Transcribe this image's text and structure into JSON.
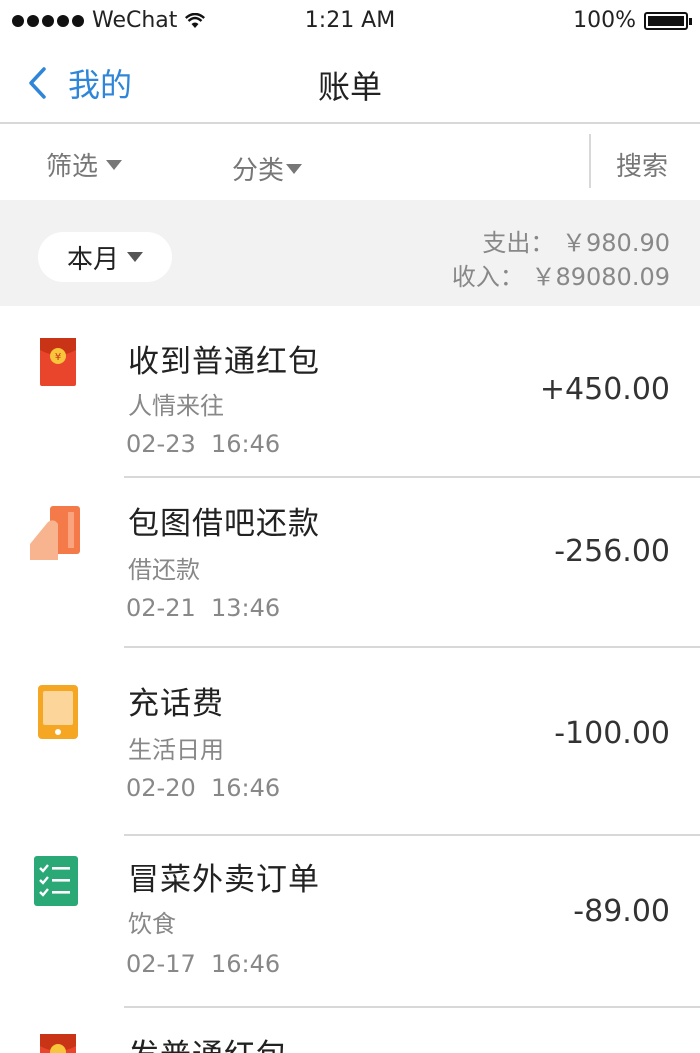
{
  "status_bar": {
    "carrier": "WeChat",
    "time": "1:21 AM",
    "battery_pct": "100%",
    "battery_level": 1.0
  },
  "nav": {
    "back_label": "我的",
    "title": "账单"
  },
  "filters": {
    "filter_label": "筛选",
    "category_label": "分类",
    "search_label": "搜索"
  },
  "summary": {
    "month_label": "本月",
    "expense_label": "支出：",
    "expense_value": "￥980.90",
    "income_label": "收入：",
    "income_value": "￥89080.09"
  },
  "transactions": [
    {
      "title": "收到普通红包",
      "category": "人情来往",
      "date": "02-23",
      "time": "16:46",
      "amount": "+450.00",
      "icon": "red-envelope-icon",
      "color": "#e8452c"
    },
    {
      "title": "包图借吧还款",
      "category": "借还款",
      "date": "02-21",
      "time": "13:46",
      "amount": "-256.00",
      "icon": "card-in-hand-icon",
      "color": "#f47a4a"
    },
    {
      "title": "充话费",
      "category": "生活日用",
      "date": "02-20",
      "time": "16:46",
      "amount": "-100.00",
      "icon": "phone-icon",
      "color": "#f5a623"
    },
    {
      "title": "冒菜外卖订单",
      "category": "饮食",
      "date": "02-17",
      "time": "16:46",
      "amount": "-89.00",
      "icon": "checklist-icon",
      "color": "#2aa876"
    },
    {
      "title": "发普通红包",
      "category": "",
      "date": "",
      "time": "",
      "amount": "",
      "icon": "red-envelope-icon",
      "color": "#e8452c"
    }
  ]
}
